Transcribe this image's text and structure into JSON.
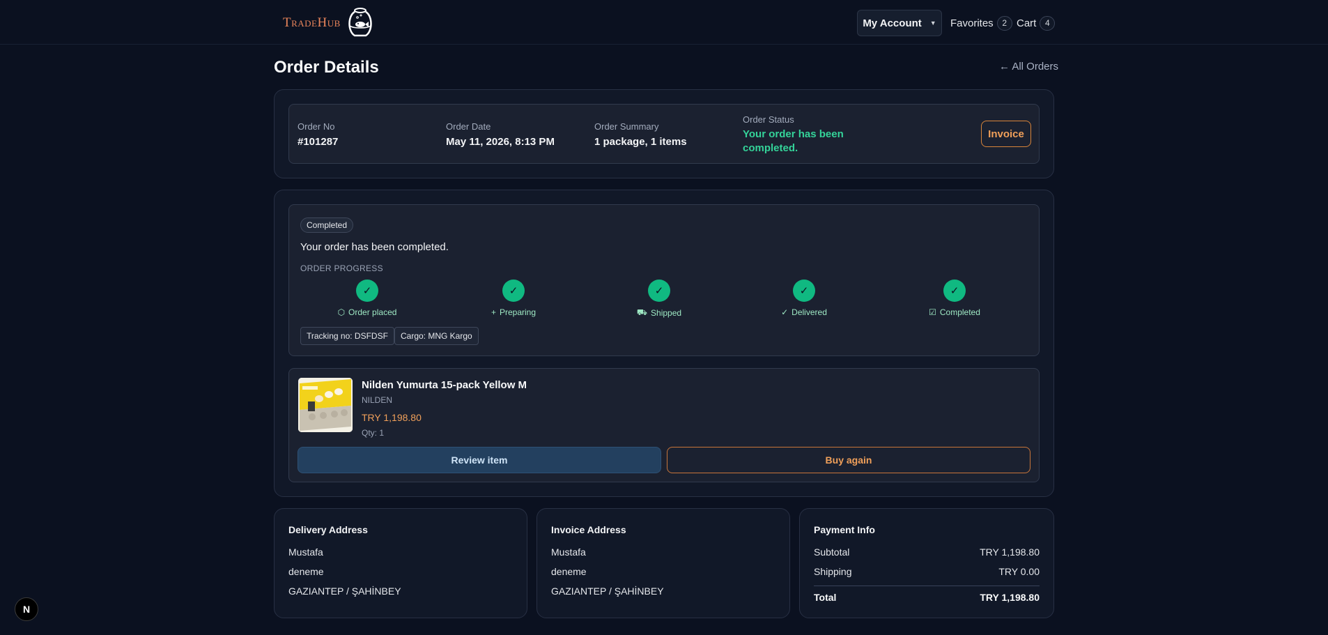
{
  "header": {
    "logo_text": "TradeHub",
    "account_label": "My Account",
    "favorites_label": "Favorites",
    "favorites_count": "2",
    "cart_label": "Cart",
    "cart_count": "4"
  },
  "page": {
    "title": "Order Details",
    "back_link": "← All Orders"
  },
  "summary": {
    "order_no_label": "Order No",
    "order_no": "#101287",
    "order_date_label": "Order Date",
    "order_date": "May 11, 2026, 8:13 PM",
    "order_summary_label": "Order Summary",
    "order_summary": "1 package, 1 items",
    "order_status_label": "Order Status",
    "order_status": "Your order has been completed.",
    "invoice_button": "Invoice"
  },
  "progress": {
    "badge": "Completed",
    "message": "Your order has been completed.",
    "section_label": "ORDER PROGRESS",
    "steps": [
      {
        "label": "Order placed",
        "icon": "box-icon",
        "glyph": "⬡"
      },
      {
        "label": "Preparing",
        "icon": "plus-icon",
        "glyph": "+"
      },
      {
        "label": "Shipped",
        "icon": "truck-icon",
        "glyph": "⛟"
      },
      {
        "label": "Delivered",
        "icon": "check-icon",
        "glyph": "✓"
      },
      {
        "label": "Completed",
        "icon": "check-square-icon",
        "glyph": "☑"
      }
    ],
    "check_glyph": "✓",
    "tracking": "Tracking no: DSFDSF",
    "cargo": "Cargo: MNG Kargo"
  },
  "product": {
    "name": "Nilden Yumurta 15-pack Yellow M",
    "brand": "NILDEN",
    "price": "TRY 1,198.80",
    "qty": "Qty: 1",
    "review_button": "Review item",
    "buy_again_button": "Buy again"
  },
  "delivery": {
    "title": "Delivery Address",
    "name": "Mustafa",
    "line": "deneme",
    "city": "GAZIANTEP / ŞAHİNBEY"
  },
  "invoice_address": {
    "title": "Invoice Address",
    "name": "Mustafa",
    "line": "deneme",
    "city": "GAZIANTEP / ŞAHİNBEY"
  },
  "payment": {
    "title": "Payment Info",
    "subtotal_label": "Subtotal",
    "subtotal": "TRY 1,198.80",
    "shipping_label": "Shipping",
    "shipping": "TRY 0.00",
    "total_label": "Total",
    "total": "TRY 1,198.80"
  },
  "dev_badge": "N"
}
